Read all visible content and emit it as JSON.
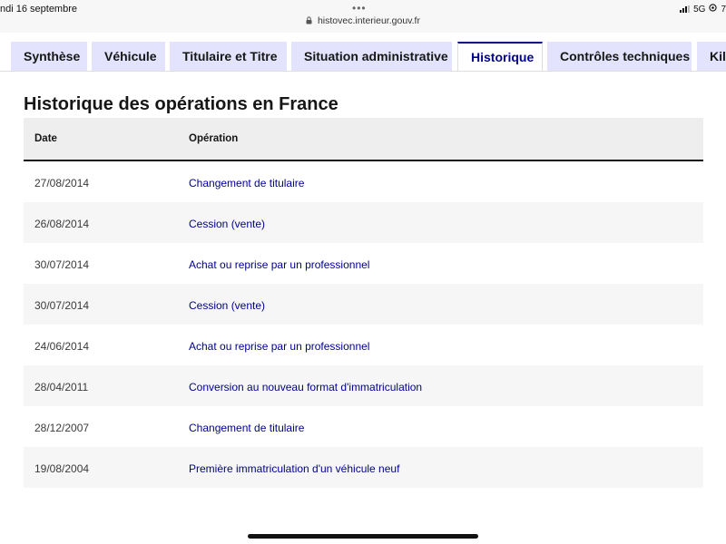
{
  "status_bar": {
    "date": "ndi 16 septembre",
    "url": "histovec.interieur.gouv.fr",
    "network": "5G",
    "battery": "7"
  },
  "tabs": [
    {
      "label": "Synthèse"
    },
    {
      "label": "Véhicule"
    },
    {
      "label": "Titulaire et Titre"
    },
    {
      "label": "Situation administrative"
    },
    {
      "label": "Historique"
    },
    {
      "label": "Contrôles techniques"
    },
    {
      "label": "Kil"
    }
  ],
  "page": {
    "title": "Historique des opérations en France"
  },
  "table": {
    "headers": {
      "date": "Date",
      "operation": "Opération"
    },
    "rows": [
      {
        "date": "27/08/2014",
        "operation": "Changement de titulaire"
      },
      {
        "date": "26/08/2014",
        "operation": "Cession (vente)"
      },
      {
        "date": "30/07/2014",
        "operation": "Achat ou reprise par un professionnel"
      },
      {
        "date": "30/07/2014",
        "operation": "Cession (vente)"
      },
      {
        "date": "24/06/2014",
        "operation": "Achat ou reprise par un professionnel"
      },
      {
        "date": "28/04/2011",
        "operation": "Conversion au nouveau format d'immatriculation"
      },
      {
        "date": "28/12/2007",
        "operation": "Changement de titulaire"
      },
      {
        "date": "19/08/2004",
        "operation": "Première immatriculation d'un véhicule neuf"
      }
    ]
  }
}
